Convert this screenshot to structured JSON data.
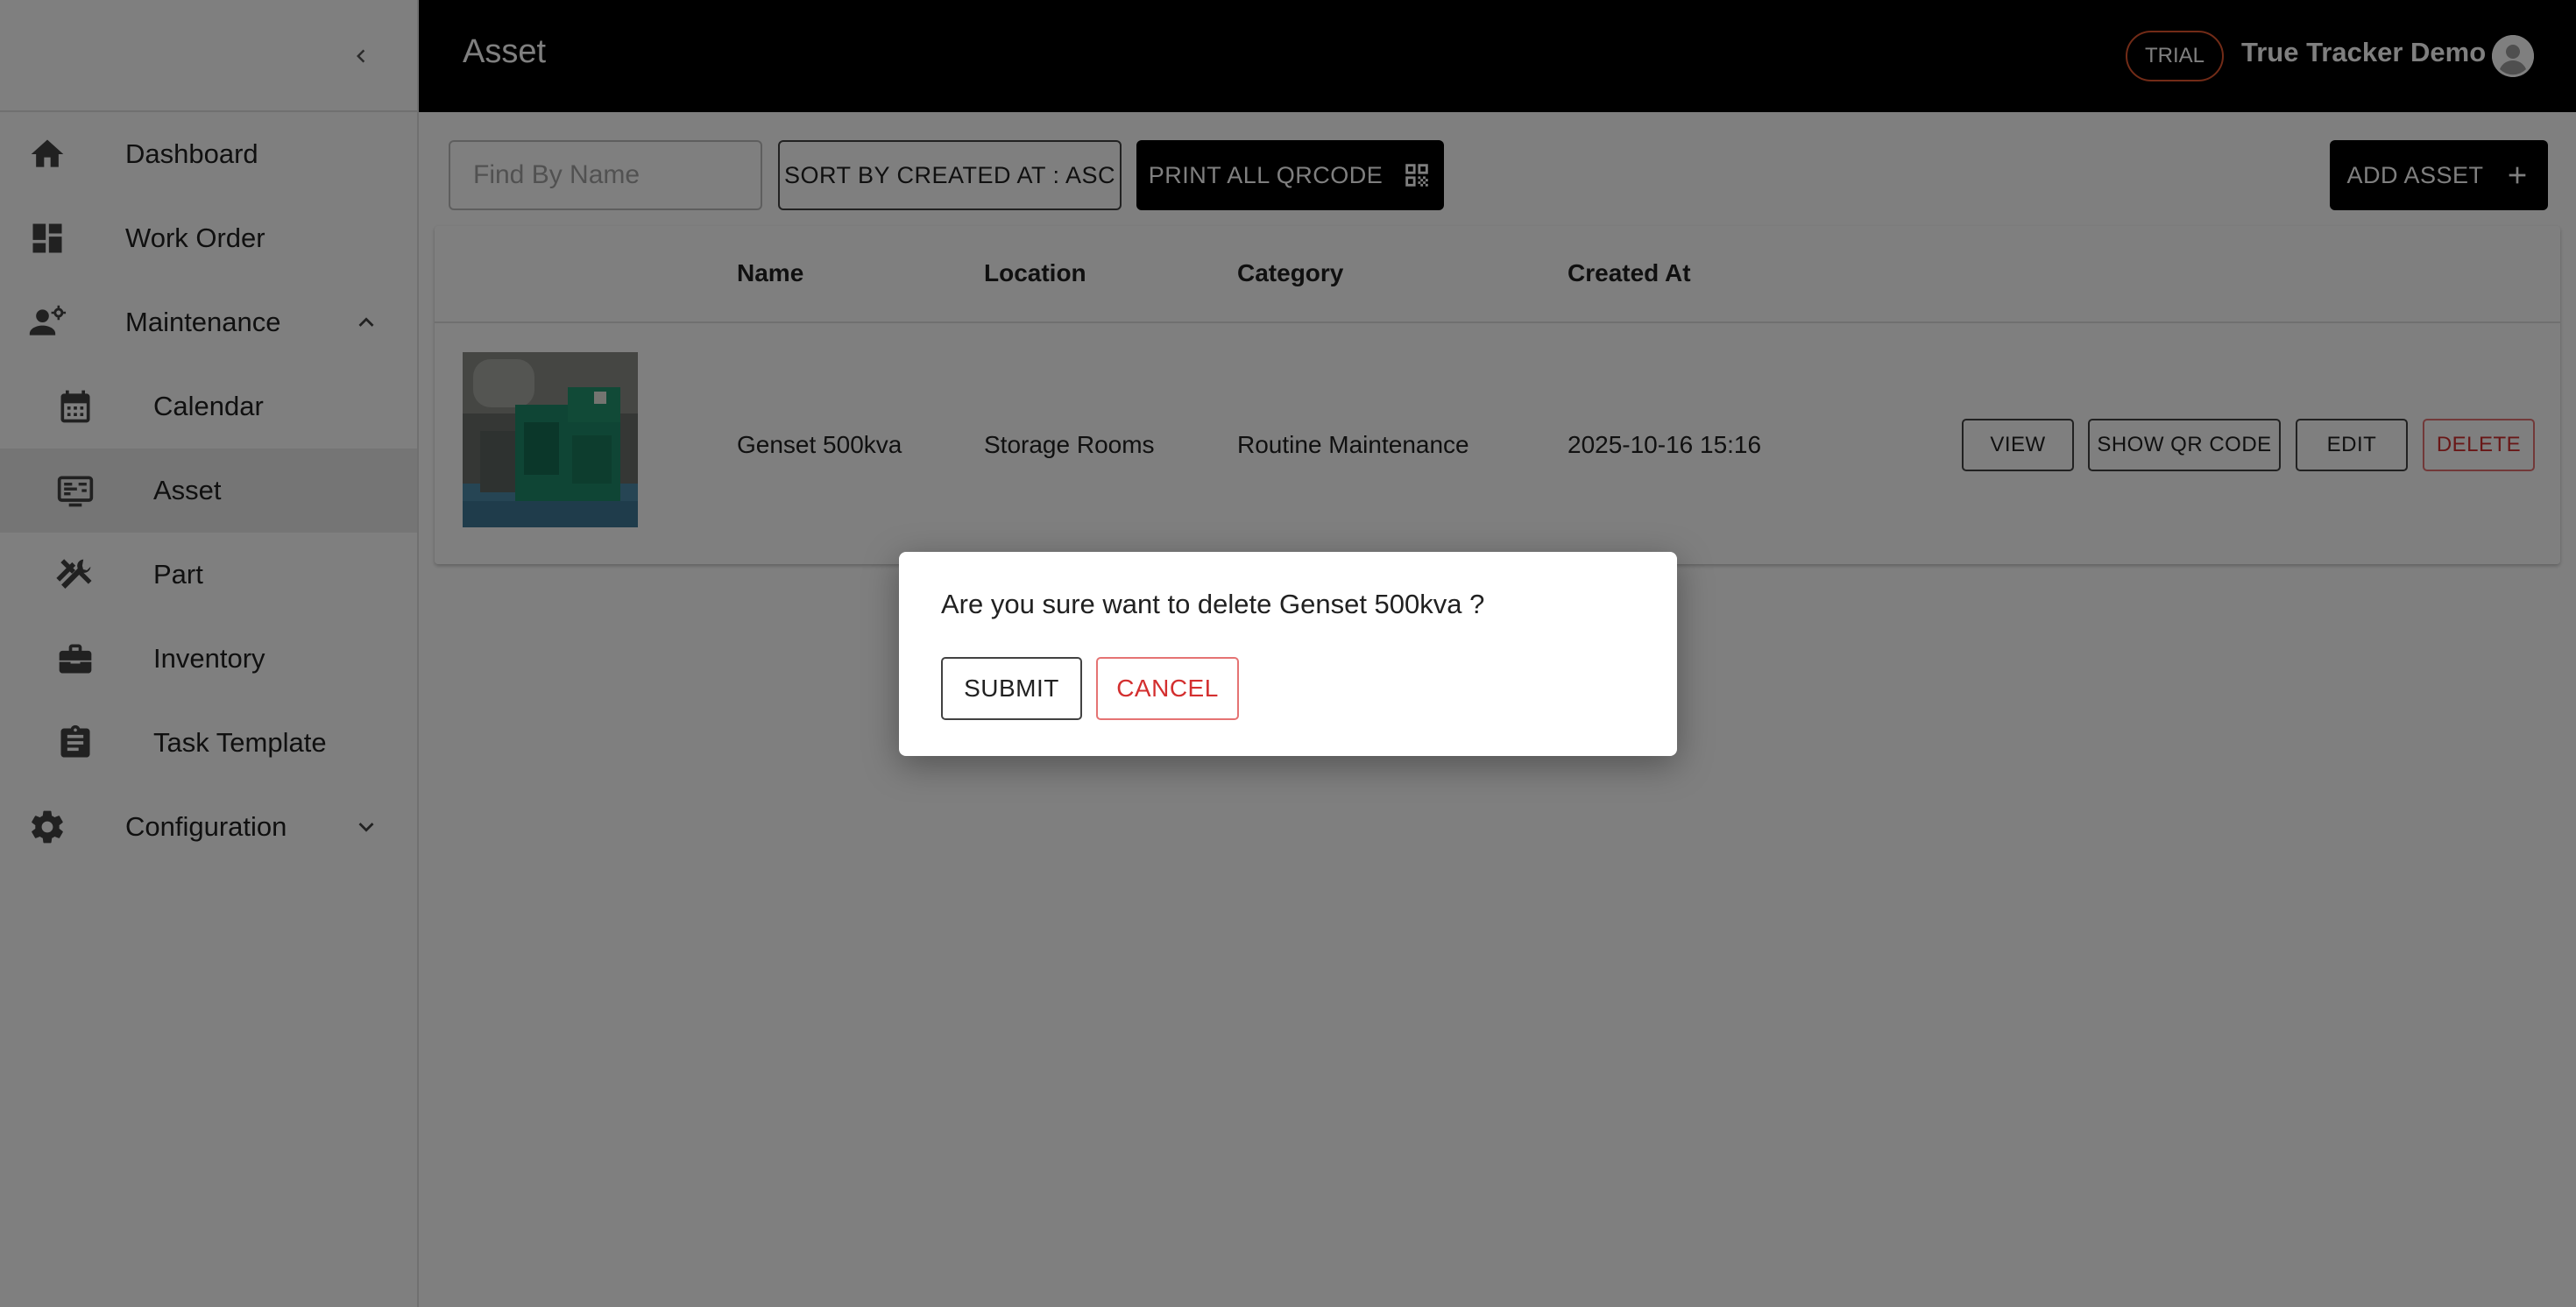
{
  "colors": {
    "appbar_bg": "#000000",
    "trial_border": "#e4572e",
    "danger": "#d32f2f",
    "active_nav_bg": "#ebebeb",
    "overlay": "rgba(0,0,0,0.5)"
  },
  "sidebar": {
    "collapse_icon": "chevron-left-icon",
    "items": [
      {
        "label": "Dashboard",
        "icon": "home-icon"
      },
      {
        "label": "Work Order",
        "icon": "dashboard-grid-icon"
      },
      {
        "label": "Maintenance",
        "icon": "engineer-icon",
        "expanded": true
      },
      {
        "label": "Calendar",
        "icon": "calendar-icon"
      },
      {
        "label": "Asset",
        "icon": "asset-list-icon",
        "active": true
      },
      {
        "label": "Part",
        "icon": "tools-icon"
      },
      {
        "label": "Inventory",
        "icon": "toolbox-icon"
      },
      {
        "label": "Task Template",
        "icon": "clipboard-icon"
      },
      {
        "label": "Configuration",
        "icon": "gear-icon",
        "expanded": false
      }
    ]
  },
  "header": {
    "title": "Asset",
    "trial_label": "TRIAL",
    "account_name": "True Tracker Demo",
    "avatar_icon": "account-circle-icon"
  },
  "toolbar": {
    "search_placeholder": "Find By Name",
    "search_value": "",
    "sort_label": "SORT BY CREATED AT : ASC",
    "print_label": "PRINT ALL QRCODE",
    "print_icon": "qr-code-icon",
    "add_label": "ADD ASSET",
    "add_icon": "plus-icon"
  },
  "table": {
    "columns": [
      "",
      "Name",
      "Location",
      "Category",
      "Created At"
    ],
    "rows": [
      {
        "thumbnail": "genset-photo",
        "name": "Genset 500kva",
        "location": "Storage Rooms",
        "category": "Routine Maintenance",
        "created_at": "2025-10-16 15:16",
        "actions": [
          "VIEW",
          "SHOW QR CODE",
          "EDIT",
          "DELETE"
        ]
      }
    ]
  },
  "dialog": {
    "message": "Are you sure want to delete Genset 500kva ?",
    "submit_label": "SUBMIT",
    "cancel_label": "CANCEL"
  }
}
